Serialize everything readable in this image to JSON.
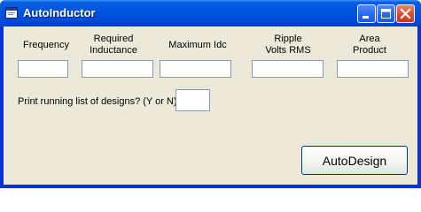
{
  "window": {
    "title": "AutoInductor",
    "icon": "app-window-icon",
    "controls": [
      "minimize-icon",
      "maximize-icon",
      "close-icon"
    ]
  },
  "fields": [
    {
      "label_lines": [
        "Frequency"
      ],
      "value": ""
    },
    {
      "label_lines": [
        "Required",
        "Inductance"
      ],
      "value": ""
    },
    {
      "label_lines": [
        "Maximum Idc"
      ],
      "value": ""
    },
    {
      "label_lines": [
        "Ripple",
        "Volts RMS"
      ],
      "value": ""
    },
    {
      "label_lines": [
        "Area",
        "Product"
      ],
      "value": ""
    }
  ],
  "print_list": {
    "label": "Print running list of designs? (Y or N):",
    "value": ""
  },
  "action_button": {
    "label": "AutoDesign"
  },
  "colors": {
    "title_bar": "#0054e3",
    "dialog_face": "#ece9d8",
    "input_border": "#7f9db9",
    "close_button": "#dd4d2c"
  }
}
